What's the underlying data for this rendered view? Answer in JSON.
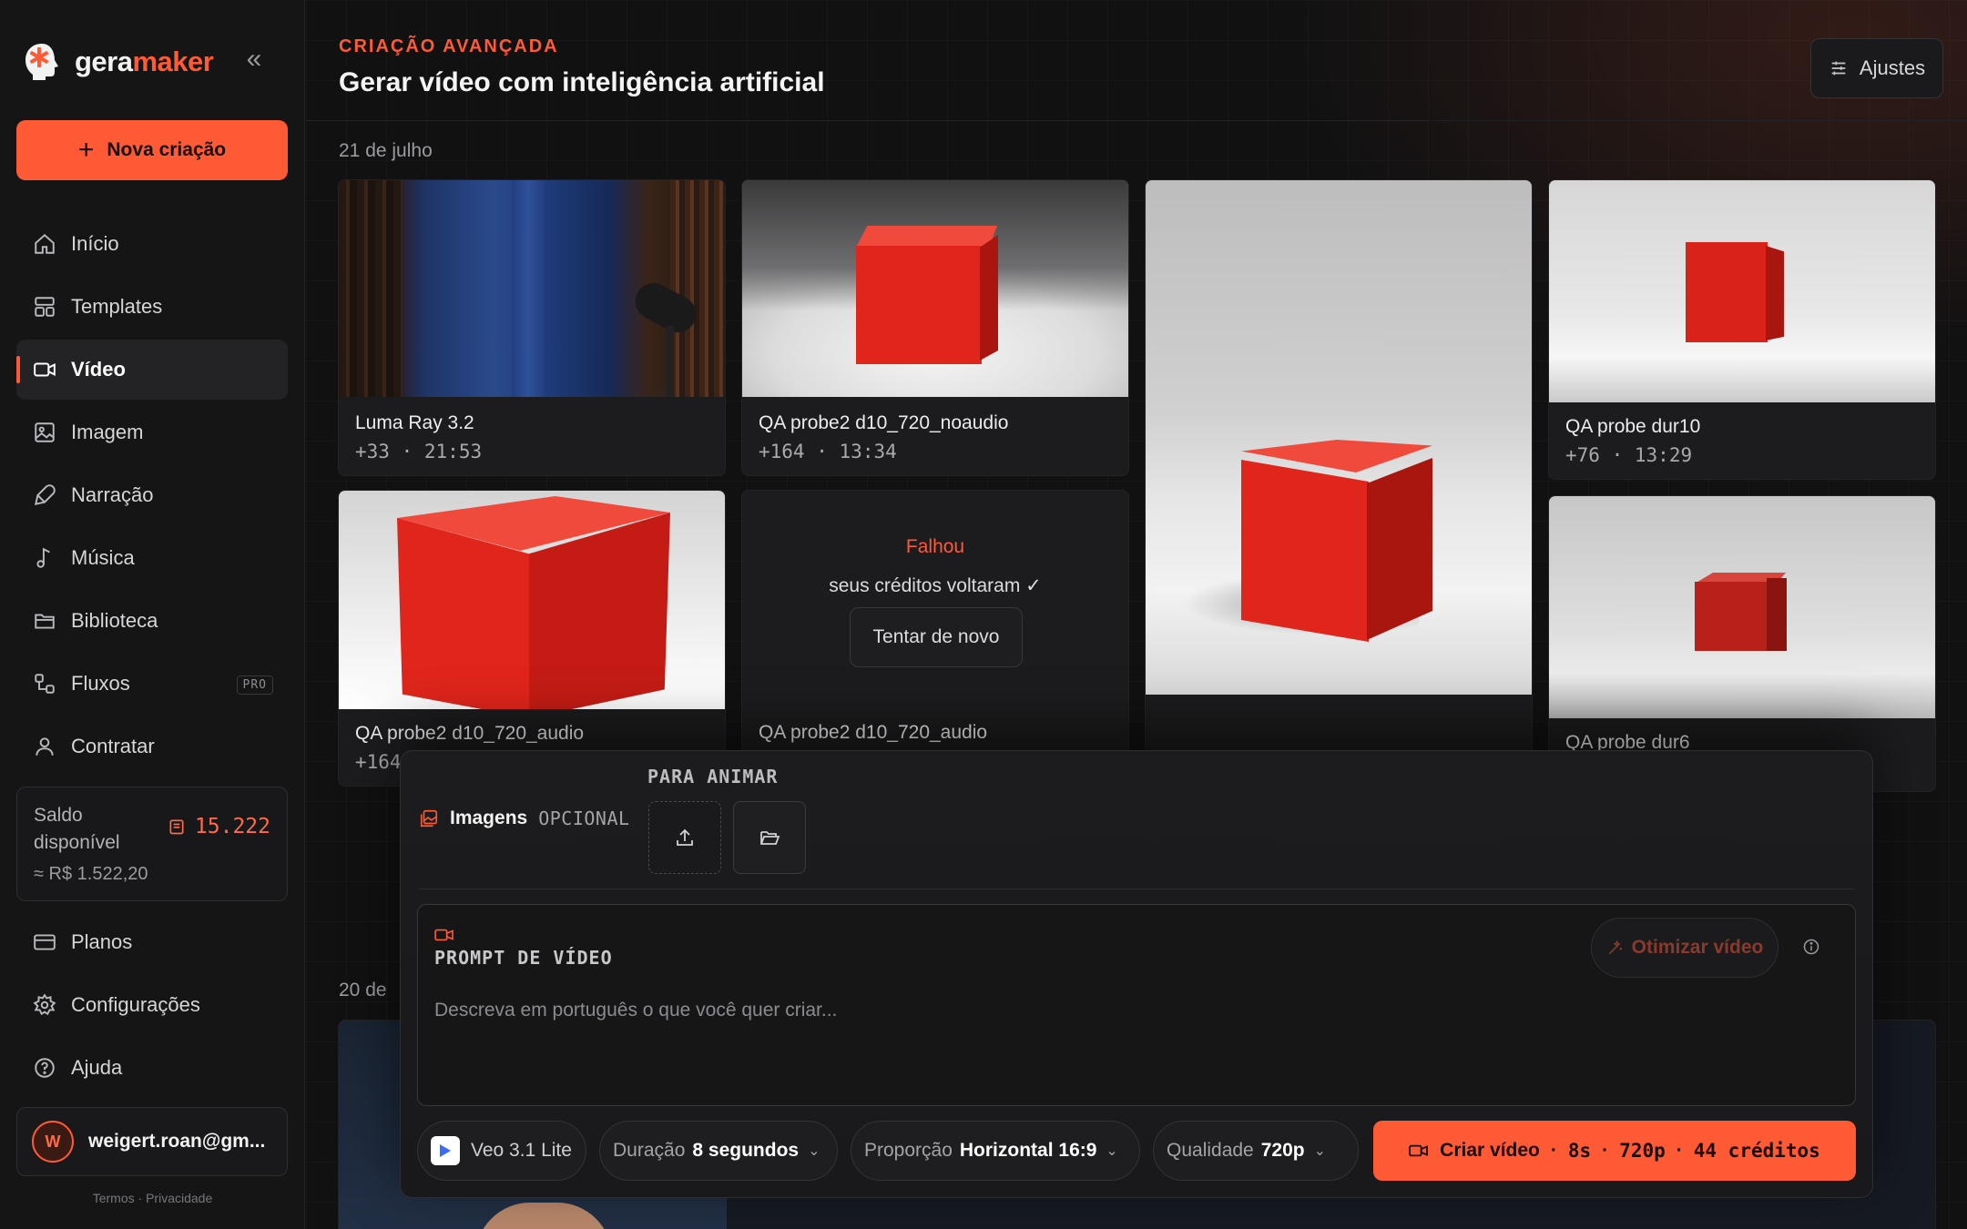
{
  "sidebar": {
    "brand_prefix": "gera",
    "brand_suffix": "maker",
    "collapse_glyph": "«",
    "new_button": "Nova criação",
    "items": [
      {
        "label": "Início",
        "icon": "home-icon"
      },
      {
        "label": "Templates",
        "icon": "layout-icon"
      },
      {
        "label": "Vídeo",
        "icon": "video-icon",
        "active": true
      },
      {
        "label": "Imagem",
        "icon": "image-icon"
      },
      {
        "label": "Narração",
        "icon": "microphone-icon"
      },
      {
        "label": "Música",
        "icon": "music-note-icon"
      },
      {
        "label": "Biblioteca",
        "icon": "folder-icon"
      },
      {
        "label": "Fluxos",
        "icon": "workflow-icon",
        "badge": "PRO"
      },
      {
        "label": "Contratar",
        "icon": "user-icon"
      }
    ],
    "balance": {
      "label": "Saldo disponível",
      "value": "15.222",
      "approx": "≈ R$ 1.522,20"
    },
    "bottom_items": [
      {
        "label": "Planos",
        "icon": "credit-card-icon"
      },
      {
        "label": "Configurações",
        "icon": "gear-icon"
      },
      {
        "label": "Ajuda",
        "icon": "help-circle-icon"
      }
    ],
    "user": {
      "initial": "W",
      "email": "weigert.roan@gm..."
    },
    "legal": {
      "terms": "Termos",
      "sep": "·",
      "privacy": "Privacidade"
    }
  },
  "header": {
    "eyebrow": "CRIAÇÃO AVANÇADA",
    "title": "Gerar vídeo com inteligência artificial",
    "settings_button": "Ajustes"
  },
  "gallery": {
    "date_1": "21 de julho",
    "date_2": "20 de",
    "cards": [
      {
        "title": "Luma Ray 3.2",
        "credits": "+33",
        "time": "21:53"
      },
      {
        "title": "QA probe2 d10_720_noaudio",
        "credits": "+164",
        "time": "13:34"
      },
      {
        "title": "QA probe dur10",
        "credits": "+76",
        "time": "13:29"
      },
      {
        "title": "QA probe2 d10_720_audio",
        "credits": "+164"
      },
      {
        "title": "QA probe2 d10_720_audio",
        "failed": true
      },
      {
        "title": "QA probe dur6"
      }
    ],
    "meta_sep": "·",
    "failed": {
      "title": "Falhou",
      "subtitle": "seus créditos voltaram ✓",
      "retry": "Tentar de novo"
    }
  },
  "composer": {
    "images_label": "Imagens",
    "images_optional": "OPCIONAL",
    "animate_label": "PARA ANIMAR",
    "prompt_label": "PROMPT DE VÍDEO",
    "prompt_placeholder": "Descreva em português o que você quer criar...",
    "prompt_value": "",
    "optimize_button": "Otimizar vídeo",
    "model": "Veo 3.1 Lite",
    "duration": {
      "label": "Duração",
      "value": "8 segundos"
    },
    "aspect": {
      "label": "Proporção",
      "value": "Horizontal 16:9"
    },
    "quality": {
      "label": "Qualidade",
      "value": "720p"
    },
    "create": {
      "label": "Criar vídeo",
      "duration": "8s",
      "quality": "720p",
      "cost": "44 créditos"
    }
  },
  "colors": {
    "accent": "#ff5a36",
    "background": "#111112",
    "sidebar": "#151516"
  }
}
